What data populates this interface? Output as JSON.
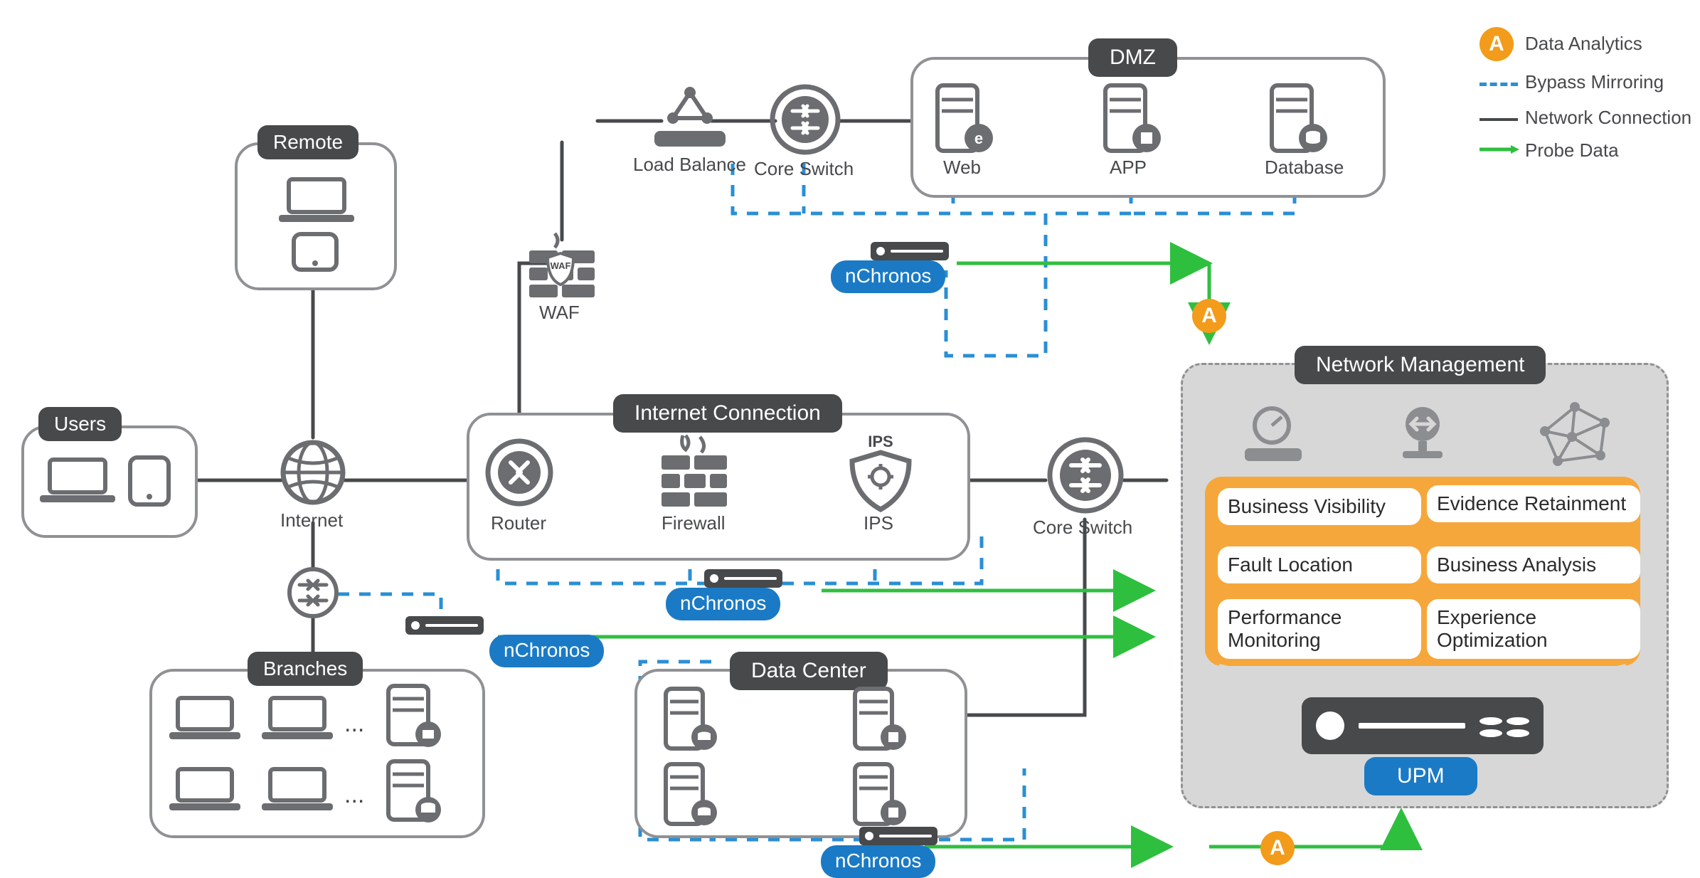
{
  "legend": {
    "a_badge": "A",
    "data_analytics": "Data Analytics",
    "bypass_mirroring": "Bypass Mirroring",
    "network_connection": "Network Connection",
    "probe_data": "Probe Data"
  },
  "titles": {
    "remote": "Remote",
    "users": "Users",
    "branches": "Branches",
    "internet_connection": "Internet Connection",
    "dmz": "DMZ",
    "data_center": "Data Center",
    "network_management": "Network Management"
  },
  "labels": {
    "internet": "Internet",
    "router": "Router",
    "firewall": "Firewall",
    "ips": "IPS",
    "core_switch": "Core Switch",
    "waf": "WAF",
    "load_balance": "Load Balance",
    "core_switch2": "Core Switch",
    "web": "Web",
    "app": "APP",
    "database": "Database",
    "nchronos": "nChronos",
    "upm": "UPM"
  },
  "nm_cards": {
    "bv": "Business Visibility",
    "er": "Evidence Retainment",
    "fl": "Fault Location",
    "ba": "Business Analysis",
    "pm": "Performance Monitoring",
    "eo": "Experience Optimization"
  },
  "a": "A"
}
